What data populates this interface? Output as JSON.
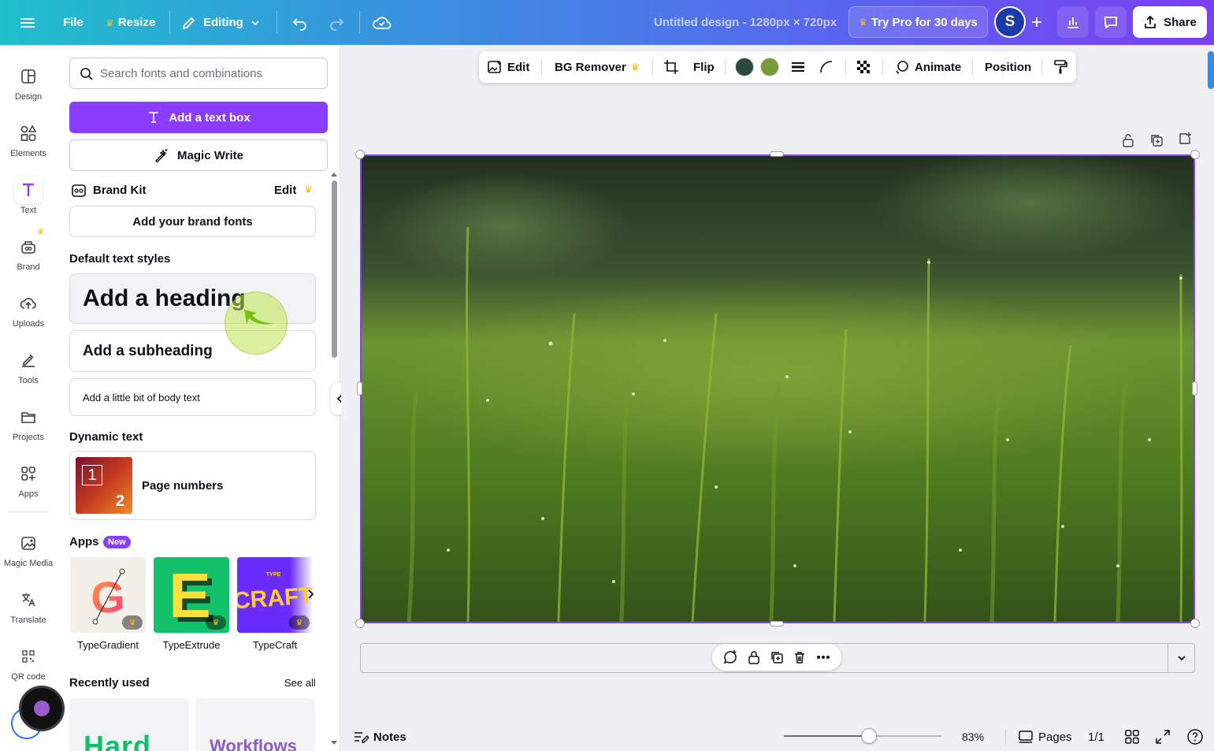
{
  "topbar": {
    "file": "File",
    "resize": "Resize",
    "editing": "Editing",
    "doc_title": "Untitled design - 1280px × 720px",
    "try_pro": "Try Pro for 30 days",
    "avatar_initial": "S",
    "share": "Share"
  },
  "rail": [
    {
      "label": "Design",
      "icon": "design-icon"
    },
    {
      "label": "Elements",
      "icon": "elements-icon"
    },
    {
      "label": "Text",
      "icon": "text-icon"
    },
    {
      "label": "Brand",
      "icon": "brand-icon"
    },
    {
      "label": "Uploads",
      "icon": "uploads-icon"
    },
    {
      "label": "Tools",
      "icon": "tools-icon"
    },
    {
      "label": "Projects",
      "icon": "projects-icon"
    },
    {
      "label": "Apps",
      "icon": "apps-icon"
    },
    {
      "label": "Magic Media",
      "icon": "magic-media-icon"
    },
    {
      "label": "Translate",
      "icon": "translate-icon"
    },
    {
      "label": "QR code",
      "icon": "qr-code-icon"
    }
  ],
  "panel": {
    "search_placeholder": "Search fonts and combinations",
    "add_text_box": "Add a text box",
    "magic_write": "Magic Write",
    "brand_kit": "Brand Kit",
    "brand_kit_edit": "Edit",
    "add_brand_fonts": "Add your brand fonts",
    "default_styles": "Default text styles",
    "heading": "Add a heading",
    "subheading": "Add a subheading",
    "body": "Add a little bit of body text",
    "dynamic_text": "Dynamic text",
    "page_numbers": "Page numbers",
    "apps_title": "Apps",
    "apps_badge": "New",
    "apps": [
      {
        "name": "TypeGradient"
      },
      {
        "name": "TypeExtrude"
      },
      {
        "name": "TypeCraft"
      }
    ],
    "recently_used": "Recently used",
    "see_all": "See all",
    "recent": [
      "Hard",
      "Workflows"
    ]
  },
  "context_toolbar": {
    "edit": "Edit",
    "bg_remover": "BG Remover",
    "flip": "Flip",
    "colors": [
      "#2b4a3a",
      "#7a9a3a"
    ],
    "animate": "Animate",
    "position": "Position"
  },
  "bottom": {
    "notes": "Notes",
    "zoom": "83%",
    "pages": "Pages",
    "page_count": "1/1"
  },
  "colors": {
    "accent": "#8b3dff"
  }
}
